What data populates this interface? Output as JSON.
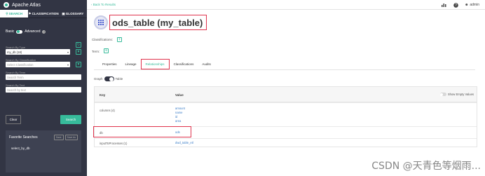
{
  "sidebar": {
    "brand": "Apache Atlas",
    "tabs": [
      {
        "icon": "search-icon",
        "label": "SEARCH"
      },
      {
        "icon": "tag-icon",
        "label": "CLASSIFICATION"
      },
      {
        "icon": "book-icon",
        "label": "GLOSSARY"
      }
    ],
    "basic_label": "Basic",
    "advanced_label": "Advanced",
    "search_by_type_label": "Search By Type",
    "search_by_type_value": "my_db (18)",
    "search_by_classification_label": "Search By Classification",
    "search_by_classification_placeholder": "Select Classification",
    "search_by_term_label": "Search By Term",
    "search_by_term_placeholder": "Search Term",
    "search_by_text_label": "Search By Text",
    "search_by_text_placeholder": "Search by text",
    "clear_label": "Clear",
    "search_label": "Search",
    "favorites_title": "Favorite Searches",
    "save_label": "Save",
    "save_as_label": "Save As",
    "favorite_item": "select_by_db"
  },
  "header": {
    "back_label": "Back To Results",
    "user_label": "admin"
  },
  "entity": {
    "title": "ods_table (my_table)",
    "classifications_label": "Classifications:",
    "term_label": "Term:"
  },
  "tabs": [
    "Properties",
    "Lineage",
    "Relationships",
    "Classifications",
    "Audits"
  ],
  "view": {
    "graph_label": "Graph",
    "table_label": "Table"
  },
  "table": {
    "key_header": "Key",
    "value_header": "Value",
    "show_empty_label": "Show Empty Values",
    "rows": [
      {
        "key": "columns (4)",
        "values": [
          "amount",
          "name",
          "id",
          "area"
        ]
      },
      {
        "key": "db",
        "values": [
          "ods"
        ]
      },
      {
        "key": "inputToProcesses (1)",
        "values": [
          "dwd_table_etl"
        ]
      }
    ]
  },
  "watermark": "CSDN @天青色等烟雨..."
}
